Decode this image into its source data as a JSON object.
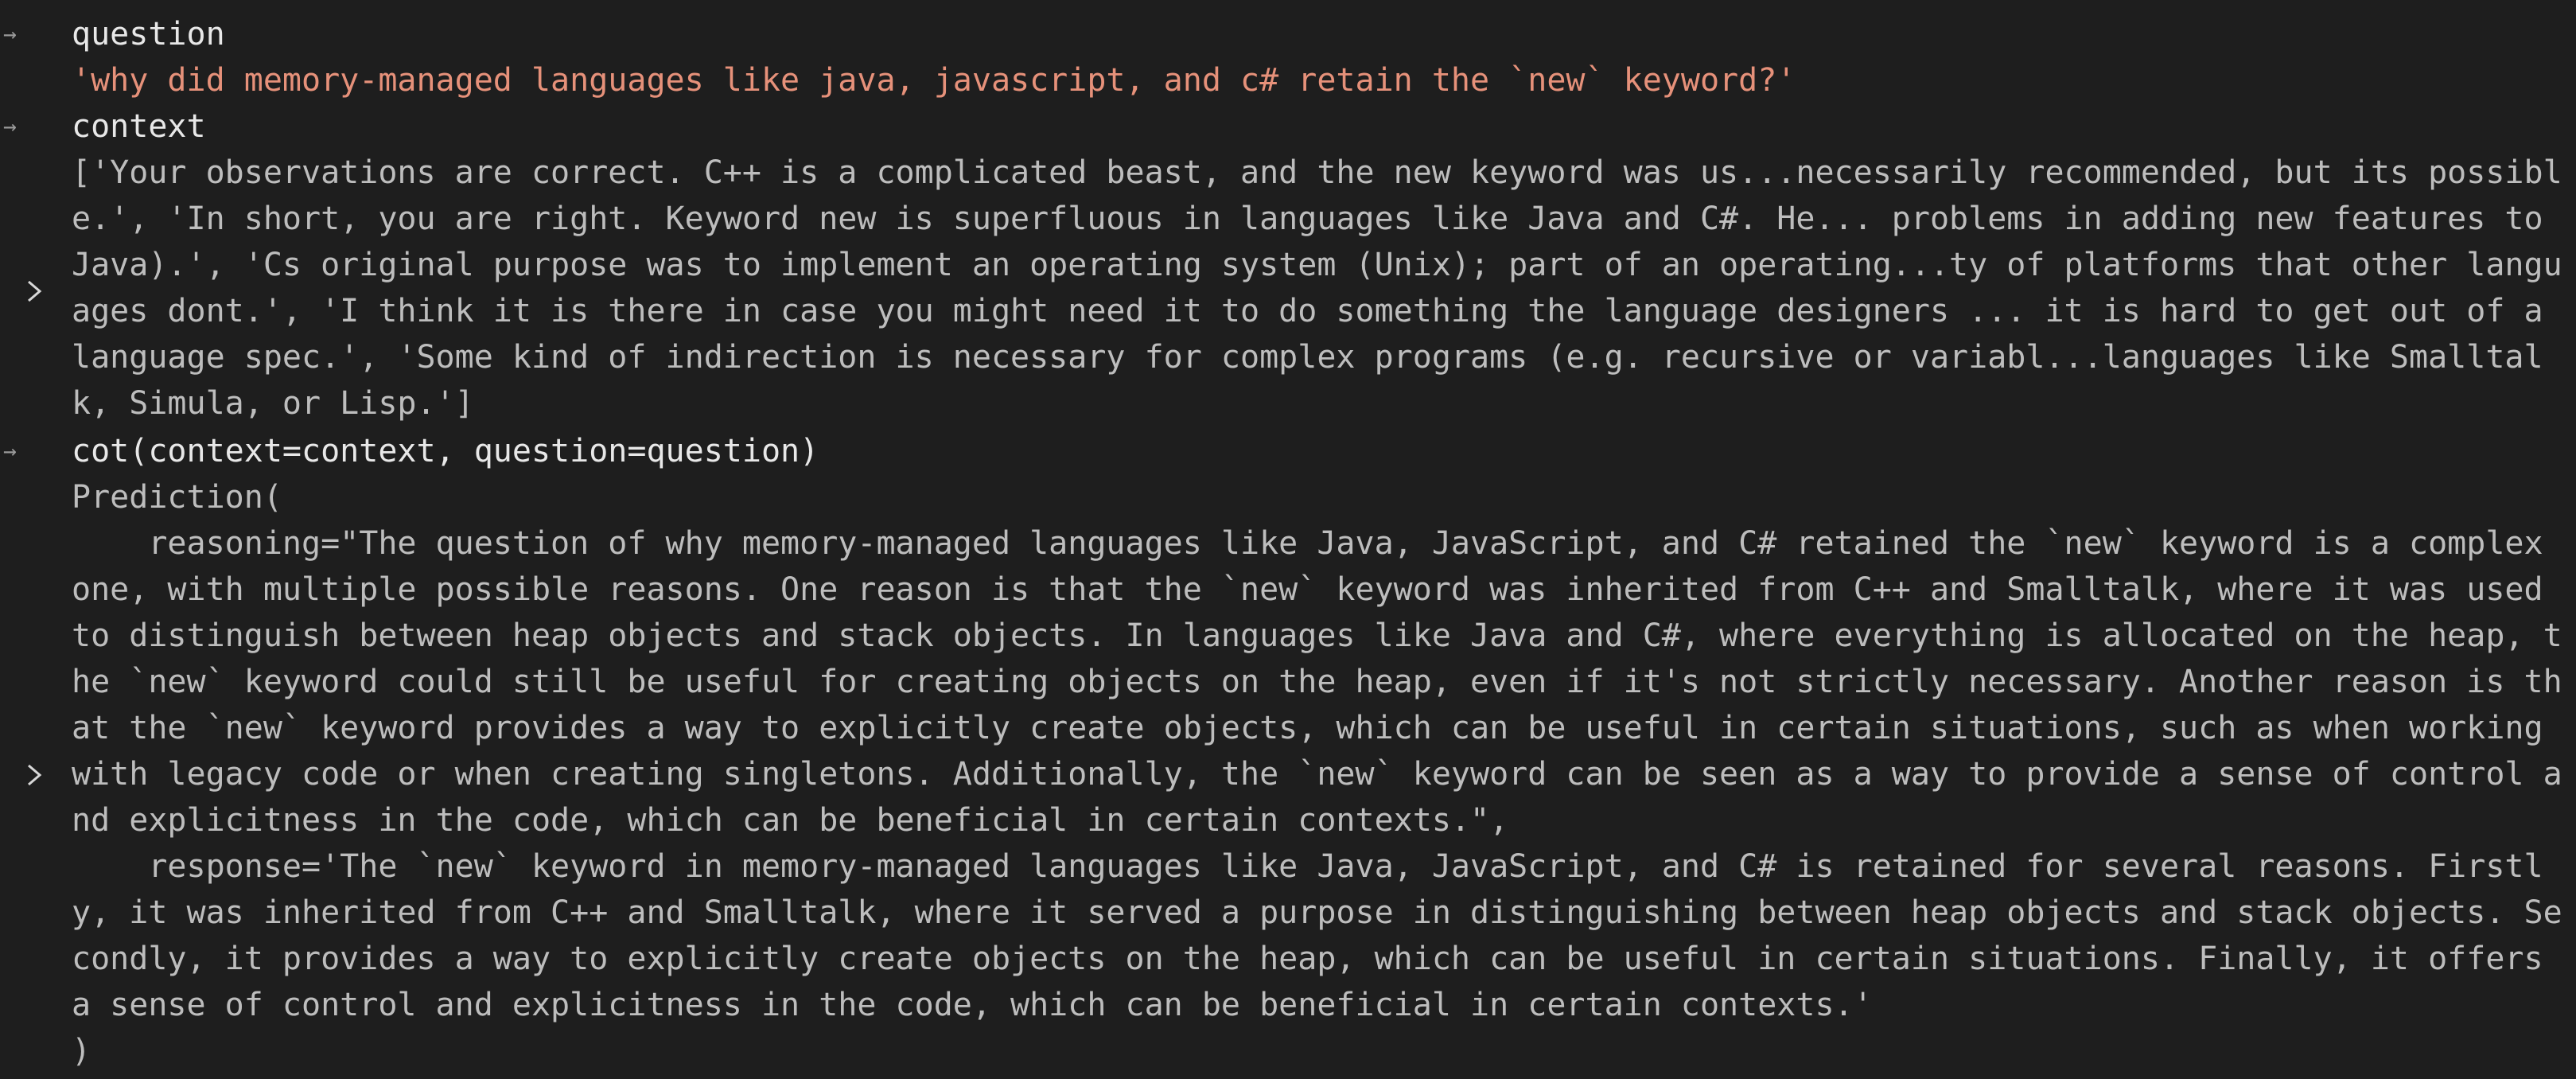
{
  "cells": {
    "question": {
      "label": "question",
      "output": "'why did memory-managed languages like java, javascript, and c# retain the `new` keyword?'"
    },
    "context": {
      "label": "context",
      "output": "['Your observations are correct. C++ is a complicated beast, and the new keyword was us...necessarily recommended, but its possible.', 'In short, you are right. Keyword new is superfluous in languages like Java and C#. He... problems in adding new features to Java).', 'Cs original purpose was to implement an operating system (Unix); part of an operating...ty of platforms that other languages dont.', 'I think it is there in case you might need it to do something the language designers ... it is hard to get out of a language spec.', 'Some kind of indirection is necessary for complex programs (e.g. recursive or variabl...languages like Smalltalk, Simula, or Lisp.']"
    },
    "cot": {
      "label": "cot(context=context, question=question)",
      "open": "Prediction(",
      "reasoning": "    reasoning=\"The question of why memory-managed languages like Java, JavaScript, and C# retained the `new` keyword is a complex one, with multiple possible reasons. One reason is that the `new` keyword was inherited from C++ and Smalltalk, where it was used to distinguish between heap objects and stack objects. In languages like Java and C#, where everything is allocated on the heap, the `new` keyword could still be useful for creating objects on the heap, even if it's not strictly necessary. Another reason is that the `new` keyword provides a way to explicitly create objects, which can be useful in certain situations, such as when working with legacy code or when creating singletons. Additionally, the `new` keyword can be seen as a way to provide a sense of control and explicitness in the code, which can be beneficial in certain contexts.\",",
      "response": "    response='The `new` keyword in memory-managed languages like Java, JavaScript, and C# is retained for several reasons. Firstly, it was inherited from C++ and Smalltalk, where it served a purpose in distinguishing between heap objects and stack objects. Secondly, it provides a way to explicitly create objects on the heap, which can be useful in certain situations. Finally, it offers a sense of control and explicitness in the code, which can be beneficial in certain contexts.'",
      "close": ")"
    }
  },
  "icons": {
    "input_marker": "arrow-right-icon",
    "expand": "chevron-right-icon"
  },
  "colors": {
    "background": "#1e1e1e",
    "string_output": "#e6917a",
    "label": "#e8e8e8",
    "output_text": "#bdbdbd"
  }
}
